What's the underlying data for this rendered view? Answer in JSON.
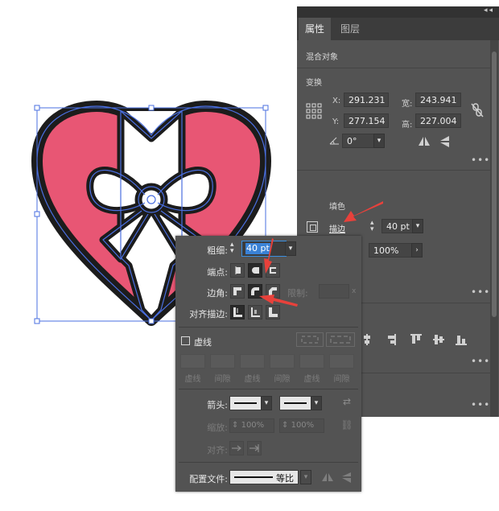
{
  "colors": {
    "heart_fill": "#e85674",
    "outline": "#1c1c1c",
    "selection_blue": "#4a6fe0",
    "panel_bg": "#535353",
    "panel_dark": "#3c3c3c",
    "annotation_arrow": "#e8413b"
  },
  "properties_panel": {
    "collapse_icon": "double-chevron-icon",
    "tabs": [
      {
        "label": "属性",
        "active": true
      },
      {
        "label": "图层",
        "active": false
      }
    ],
    "object_type": "混合对象",
    "transform": {
      "title": "变换",
      "x_label": "X:",
      "x_value": "291.231",
      "y_label": "Y:",
      "y_value": "277.154",
      "w_label": "宽:",
      "w_value": "243.941",
      "h_label": "高:",
      "h_value": "227.004",
      "angle_value": "0°"
    },
    "appearance": {
      "fill_label": "填色",
      "stroke_label": "描边",
      "stroke_weight": "40 pt",
      "opacity": "100%"
    }
  },
  "stroke_panel": {
    "weight_label": "粗细:",
    "weight_value": "40 pt",
    "cap_label": "端点:",
    "corner_label": "边角:",
    "limit_label": "限制:",
    "limit_unit": "x",
    "align_label": "对齐描边:",
    "dashed_label": "虚线",
    "dash_labels": [
      "虚线",
      "间隙",
      "虚线",
      "间隙",
      "虚线",
      "间隙"
    ],
    "arrowhead_label": "箭头:",
    "scale_label": "缩放:",
    "scale_start": "100%",
    "scale_end": "100%",
    "align_arrow_label": "对齐:",
    "profile_label": "配置文件:",
    "profile_value": "等比"
  }
}
